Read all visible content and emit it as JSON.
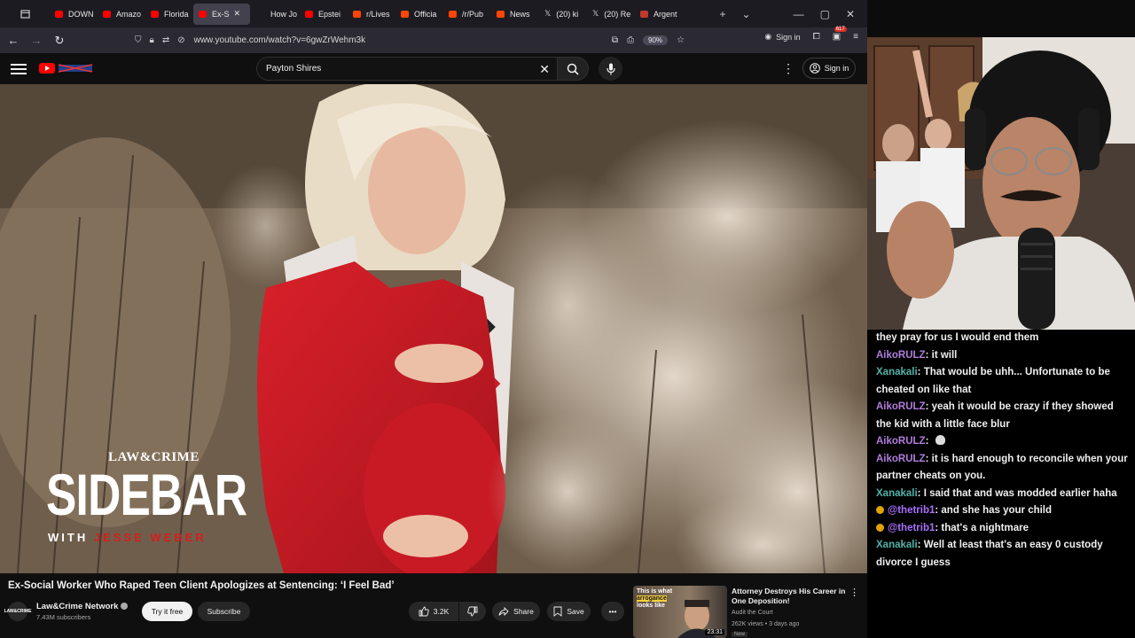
{
  "browser": {
    "tabs": [
      {
        "label": "DOWN",
        "favicon_color": "#ff0000",
        "active": false
      },
      {
        "label": "Amazo",
        "favicon_color": "#ff0000",
        "active": false
      },
      {
        "label": "Florida",
        "favicon_color": "#ff0000",
        "active": false
      },
      {
        "label": "Ex-S",
        "favicon_color": "#ff0000",
        "active": true
      },
      {
        "label": "How Jo",
        "favicon_color": "#1c1b22",
        "active": false
      },
      {
        "label": "Epstei",
        "favicon_color": "#ff0000",
        "active": false
      },
      {
        "label": "r/Lives",
        "favicon_color": "#ff4500",
        "active": false
      },
      {
        "label": "Officia",
        "favicon_color": "#ff4500",
        "active": false
      },
      {
        "label": "/r/Pub",
        "favicon_color": "#ff4500",
        "active": false
      },
      {
        "label": "News",
        "favicon_color": "#ff4500",
        "active": false
      },
      {
        "label": "(20) ki",
        "favicon_color": "x",
        "active": false
      },
      {
        "label": "(20) Re",
        "favicon_color": "x",
        "active": false
      },
      {
        "label": "Argent",
        "favicon_color": "#c0392b",
        "active": false
      }
    ],
    "url": "www.youtube.com/watch?v=6gwZrWehm3k",
    "zoom": "90%",
    "signin_label": "Sign in",
    "notification_count": "617"
  },
  "youtube": {
    "search_query": "Payton Shires",
    "signin_label": "Sign in"
  },
  "video": {
    "overlay_brand": "LAW&CRIME",
    "overlay_title": "SIDEBAR",
    "overlay_sub_prefix": "WITH ",
    "overlay_sub_name": "JESSE WEBER",
    "title": "Ex-Social Worker Who Raped Teen Client Apologizes at Sentencing: ‘I Feel Bad’",
    "channel": {
      "name": "Law&Crime Network",
      "avatar_text": "LAW&CRIME",
      "subscribers": "7.43M subscribers"
    },
    "try_free_label": "Try it free",
    "subscribe_label": "Subscribe",
    "likes": "3.2K",
    "share_label": "Share",
    "save_label": "Save"
  },
  "recommended": {
    "thumb_caption_1": "This is what",
    "thumb_caption_2": "arrogance",
    "thumb_caption_3": "looks like",
    "duration": "23:31",
    "title": "Attorney Destroys His Career in One Deposition!",
    "channel": "Audit the Court",
    "meta": "262K views • 3 days ago",
    "badge": "New"
  },
  "chat": {
    "messages": [
      {
        "user": "",
        "user_color": "#efeff1",
        "text": "they pray for us I would end them",
        "badge": false
      },
      {
        "user": "AikoRULZ",
        "user_color": "#b07ddc",
        "text": ": it will",
        "badge": false
      },
      {
        "user": "Xanakali",
        "user_color": "#4fb3a9",
        "text": ": That would be uhh... Unfortunate to be cheated on like that",
        "badge": false
      },
      {
        "user": "AikoRULZ",
        "user_color": "#b07ddc",
        "text": ": yeah it would be crazy if they showed the kid with a little face blur",
        "badge": false
      },
      {
        "user": "AikoRULZ",
        "user_color": "#b07ddc",
        "text": ": ",
        "badge": false,
        "emote": "skull"
      },
      {
        "user": "AikoRULZ",
        "user_color": "#b07ddc",
        "text": ": it is hard enough to reconcile when your partner cheats on you.",
        "badge": false
      },
      {
        "user": "Xanakali",
        "user_color": "#4fb3a9",
        "text": ": I said that and was modded earlier haha",
        "badge": false
      },
      {
        "user": "@thetrib1",
        "user_color": "#a970ff",
        "text": ": and she has your child",
        "badge": true
      },
      {
        "user": "@thetrib1",
        "user_color": "#a970ff",
        "text": ": that's a nightmare",
        "badge": true
      },
      {
        "user": "Xanakali",
        "user_color": "#4fb3a9",
        "text": ": Well at least that's an easy 0 custody divorce I guess",
        "badge": false
      }
    ]
  },
  "colors": {
    "yt_red": "#ff0000",
    "chat_bg": "#000000",
    "page_bg": "#0f0f0f"
  }
}
